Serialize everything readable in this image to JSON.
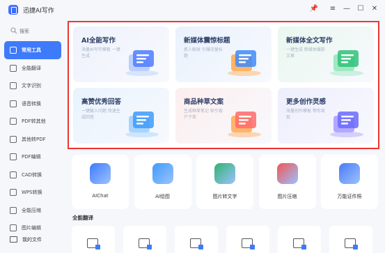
{
  "app": {
    "title": "迅捷AI写作"
  },
  "window_controls": {
    "pin": "📌",
    "menu": "≡",
    "minimize": "—",
    "maximize": "☐",
    "close": "✕"
  },
  "sidebar": {
    "search_placeholder": "搜索",
    "items": [
      {
        "label": "常用工具",
        "active": true
      },
      {
        "label": "全能翻译"
      },
      {
        "label": "文字识别"
      },
      {
        "label": "语音转换"
      },
      {
        "label": "PDF转其他"
      },
      {
        "label": "其他转PDF"
      },
      {
        "label": "PDF编辑"
      },
      {
        "label": "CAD转换"
      },
      {
        "label": "WPS转换"
      },
      {
        "label": "全能压缩"
      },
      {
        "label": "图片编辑"
      }
    ],
    "my_docs": "我的文件"
  },
  "features": [
    {
      "title": "AI全能写作",
      "desc": "海量AI写作模板 一键生成",
      "color": "#eef2fb"
    },
    {
      "title": "新媒体震惊标题",
      "desc": "抓人眼球 引爆流量标题",
      "color": "#eaf2fd"
    },
    {
      "title": "新媒体全文写作",
      "desc": "一键生成 新媒体爆款文章",
      "color": "#eaf7ef"
    },
    {
      "title": "高赞优秀回答",
      "desc": "一键输入问题 快速生成回答",
      "color": "#e9f3fd"
    },
    {
      "title": "商品种草文案",
      "desc": "生成种草笔记 吸引客户下单",
      "color": "#fdeeee"
    },
    {
      "title": "更多创作灵感",
      "desc": "海量创作模板 等你发现",
      "color": "#eeeefd"
    }
  ],
  "tools": [
    {
      "label": "AIChat",
      "color": "#3e7bfa"
    },
    {
      "label": "AI绘图",
      "color": "#3e9bfa"
    },
    {
      "label": "图片转文字",
      "color": "#2fb36f"
    },
    {
      "label": "图片压缩",
      "color": "#f05656"
    },
    {
      "label": "万能证件照",
      "color": "#4a7cf5"
    }
  ],
  "section_translate": "全能翻译",
  "doc_cards": 6
}
